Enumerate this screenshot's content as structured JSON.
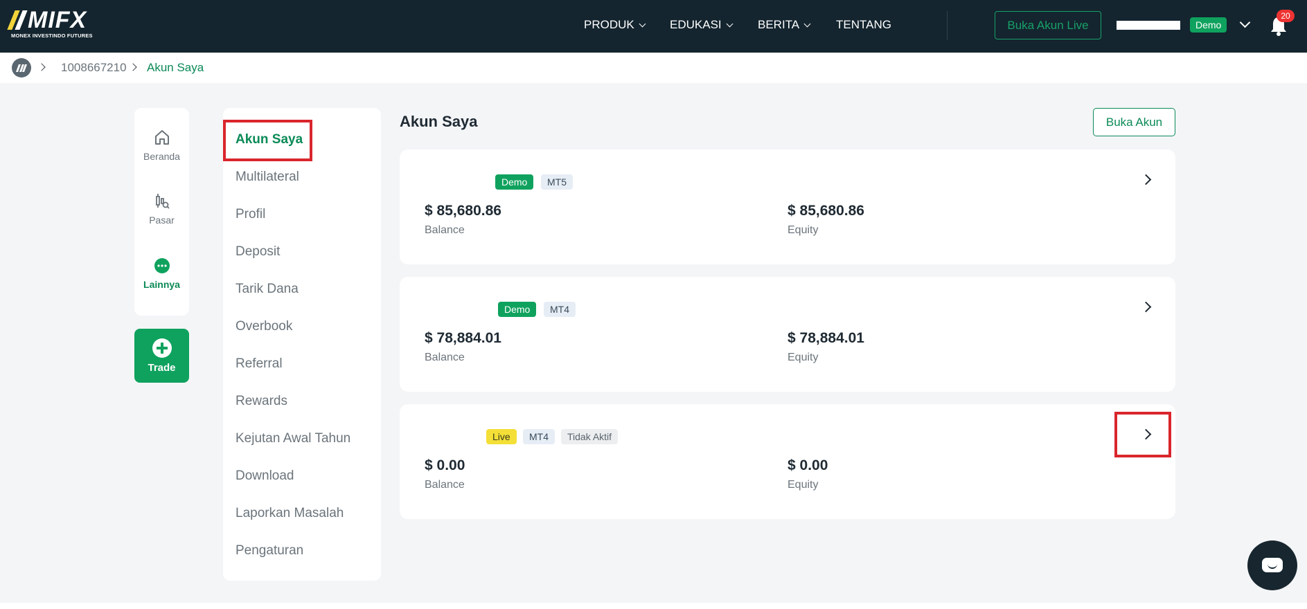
{
  "header": {
    "logo": {
      "word": "MIFX",
      "sub": "MONEX INVESTINDO FUTURES"
    },
    "nav": [
      {
        "label": "PRODUK",
        "has_dropdown": true
      },
      {
        "label": "EDUKASI",
        "has_dropdown": true
      },
      {
        "label": "BERITA",
        "has_dropdown": true
      },
      {
        "label": "TENTANG",
        "has_dropdown": false
      }
    ],
    "live_button": "Buka Akun Live",
    "account_badge": "Demo",
    "notification_count": "20",
    "icons": [
      "chevron-down-icon",
      "bell-icon"
    ]
  },
  "breadcrumb": {
    "items": [
      "1008667210",
      "Akun Saya"
    ],
    "home_icon": "mifx-logo-icon"
  },
  "rail": {
    "items": [
      {
        "label": "Beranda",
        "icon": "home-icon",
        "active": false
      },
      {
        "label": "Pasar",
        "icon": "market-icon",
        "active": false
      },
      {
        "label": "Lainnya",
        "icon": "more-icon",
        "active": true
      }
    ],
    "trade_label": "Trade"
  },
  "menu": {
    "items": [
      "Akun Saya",
      "Multilateral",
      "Profil",
      "Deposit",
      "Tarik Dana",
      "Overbook",
      "Referral",
      "Rewards",
      "Kejutan Awal Tahun",
      "Download",
      "Laporkan Masalah",
      "Pengaturan"
    ],
    "active": "Akun Saya"
  },
  "main": {
    "title": "Akun Saya",
    "open_button": "Buka Akun",
    "accounts": [
      {
        "badges": [
          "Demo",
          "MT5"
        ],
        "balance": "$ 85,680.86",
        "balance_label": "Balance",
        "equity": "$ 85,680.86",
        "equity_label": "Equity"
      },
      {
        "badges": [
          "Demo",
          "MT4"
        ],
        "balance": "$ 78,884.01",
        "balance_label": "Balance",
        "equity": "$ 78,884.01",
        "equity_label": "Equity"
      },
      {
        "badges": [
          "Live",
          "MT4",
          "Tidak Aktif"
        ],
        "balance": "$ 0.00",
        "balance_label": "Balance",
        "equity": "$ 0.00",
        "equity_label": "Equity"
      }
    ]
  },
  "colors": {
    "header_bg": "#14252f",
    "brand_green": "#0fa25e",
    "highlight_red": "#d9262c",
    "live_yellow": "#f3df37"
  }
}
